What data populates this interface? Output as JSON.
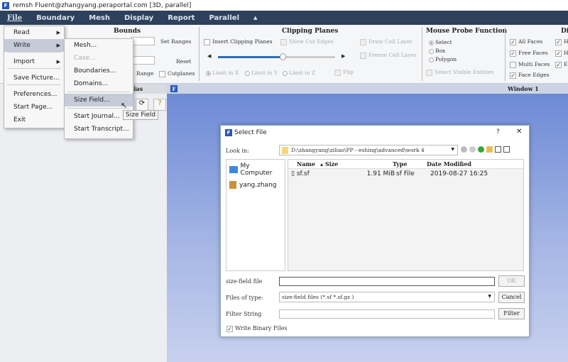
{
  "window": {
    "title": "remsh Fluent@zhangyang.peraportal.com  [3D, parallel]"
  },
  "menubar": [
    "File",
    "Boundary",
    "Mesh",
    "Display",
    "Report",
    "Parallel",
    "▲"
  ],
  "ribbon": {
    "bounds": {
      "title": "Bounds",
      "set_ranges": "Set Ranges",
      "reset": "Reset",
      "range": "Range",
      "cutplanes": "Cutplanes"
    },
    "clipping": {
      "title": "Clipping Planes",
      "insert": "Insert Clipping Planes",
      "show_cut_edges": "Show Cut Edges",
      "draw_cell_layer": "Draw Cell Layer",
      "freeze_cell_layer": "Freeze Cell Layer",
      "limit_x": "Limit in X",
      "limit_y": "Limit in Y",
      "limit_z": "Limit in Z",
      "flip": "Flip",
      "slider_value": 0.55
    },
    "probe": {
      "title": "Mouse Probe Function",
      "select": "Select",
      "box": "Box",
      "polygon": "Polygon",
      "select_visible": "Select Visible Entities"
    },
    "display": {
      "title": "Di",
      "all_faces": "All Faces",
      "free_faces": "Free Faces",
      "multi_faces": "Multi Faces",
      "face_edges": "Face Edges",
      "c1": "H",
      "c2": "H",
      "c3": "E"
    }
  },
  "panels": {
    "left_header": "...ias",
    "window_header": "Window 1"
  },
  "file_menu": {
    "items": [
      "Read",
      "Write",
      "Import",
      "Save Picture...",
      "Preferences...",
      "Start Page...",
      "Exit"
    ]
  },
  "write_menu": {
    "items": [
      "Mesh...",
      "Case...",
      "Boundaries...",
      "Domains...",
      "Size Field...",
      "Start Journal...",
      "Start Transcript..."
    ]
  },
  "tooltip": "Size Field",
  "dialog": {
    "title": "Select File",
    "help": "?",
    "close": "✕",
    "look_in_label": "Look in:",
    "look_in_value": "D:\\zhangyang\\ziliao\\PP⋯eshing\\advanced\\work 4",
    "places": [
      "My Computer",
      "yang.zhang"
    ],
    "columns": [
      "Name",
      "Size",
      "Type",
      "Date Modified"
    ],
    "files": [
      {
        "name": "sf.sf",
        "size": "1.91 MiB",
        "type": "sf File",
        "date": "2019-08-27 16:25"
      }
    ],
    "filename_label": "size-field file",
    "filename_value": "",
    "ok": "OK",
    "filetype_label": "Files of type:",
    "filetype_value": "size-field files (*.sf *.sf.gz )",
    "cancel": "Cancel",
    "filter_label": "Filter String",
    "filter_value": "",
    "filter_btn": "Filter",
    "binary_label": "Write Binary Files"
  }
}
